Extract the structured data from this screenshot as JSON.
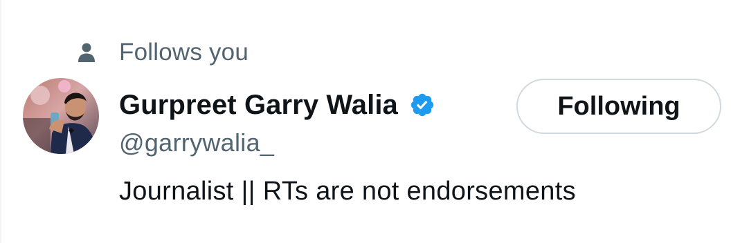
{
  "follows_label": "Follows you",
  "user": {
    "display_name": "Gurpreet Garry Walia",
    "handle": "@garrywalia_",
    "bio": "Journalist || RTs are not endorsements",
    "verified": true
  },
  "follow_button": {
    "label": "Following"
  },
  "icons": {
    "follows": "person-icon",
    "verified": "verified-badge-icon"
  },
  "colors": {
    "text_primary": "#0f1419",
    "text_secondary": "#536471",
    "verified_blue": "#1d9bf0",
    "button_border": "#cfd9de"
  }
}
